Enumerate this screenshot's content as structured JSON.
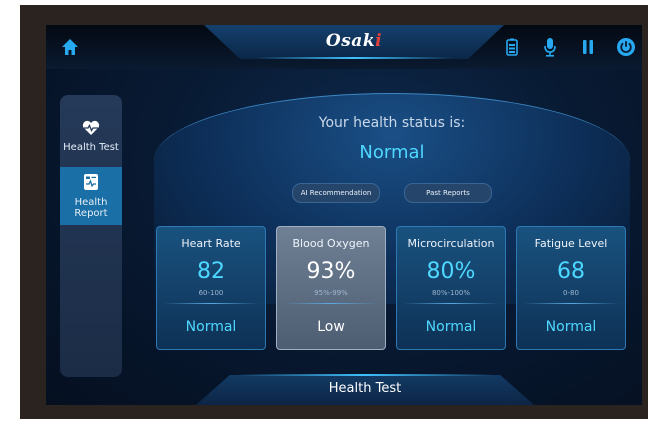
{
  "header": {
    "logo_text": "Osaki",
    "icons": [
      "home-icon",
      "battery-icon",
      "microphone-icon",
      "pause-icon",
      "power-icon"
    ]
  },
  "sidebar": {
    "items": [
      {
        "label": "Health Test",
        "icon": "heart-pulse-icon",
        "active": false
      },
      {
        "label": "Health Report",
        "icon": "report-icon",
        "active": true
      }
    ]
  },
  "status": {
    "title": "Your health status is:",
    "value": "Normal"
  },
  "actions": {
    "ai_recommendation": "AI Recommendation",
    "past_reports": "Past Reports"
  },
  "metrics": [
    {
      "title": "Heart Rate",
      "value": "82",
      "range": "60-100",
      "status": "Normal"
    },
    {
      "title": "Blood Oxygen",
      "value": "93%",
      "range": "95%-99%",
      "status": "Low"
    },
    {
      "title": "Microcirculation",
      "value": "80%",
      "range": "80%-100%",
      "status": "Normal"
    },
    {
      "title": "Fatigue Level",
      "value": "68",
      "range": "0-80",
      "status": "Normal"
    }
  ],
  "bottom_bar": {
    "label": "Health Test"
  },
  "colors": {
    "accent": "#4ed8ff",
    "icon_blue": "#27a9f2",
    "logo_accent": "#e2403a"
  }
}
